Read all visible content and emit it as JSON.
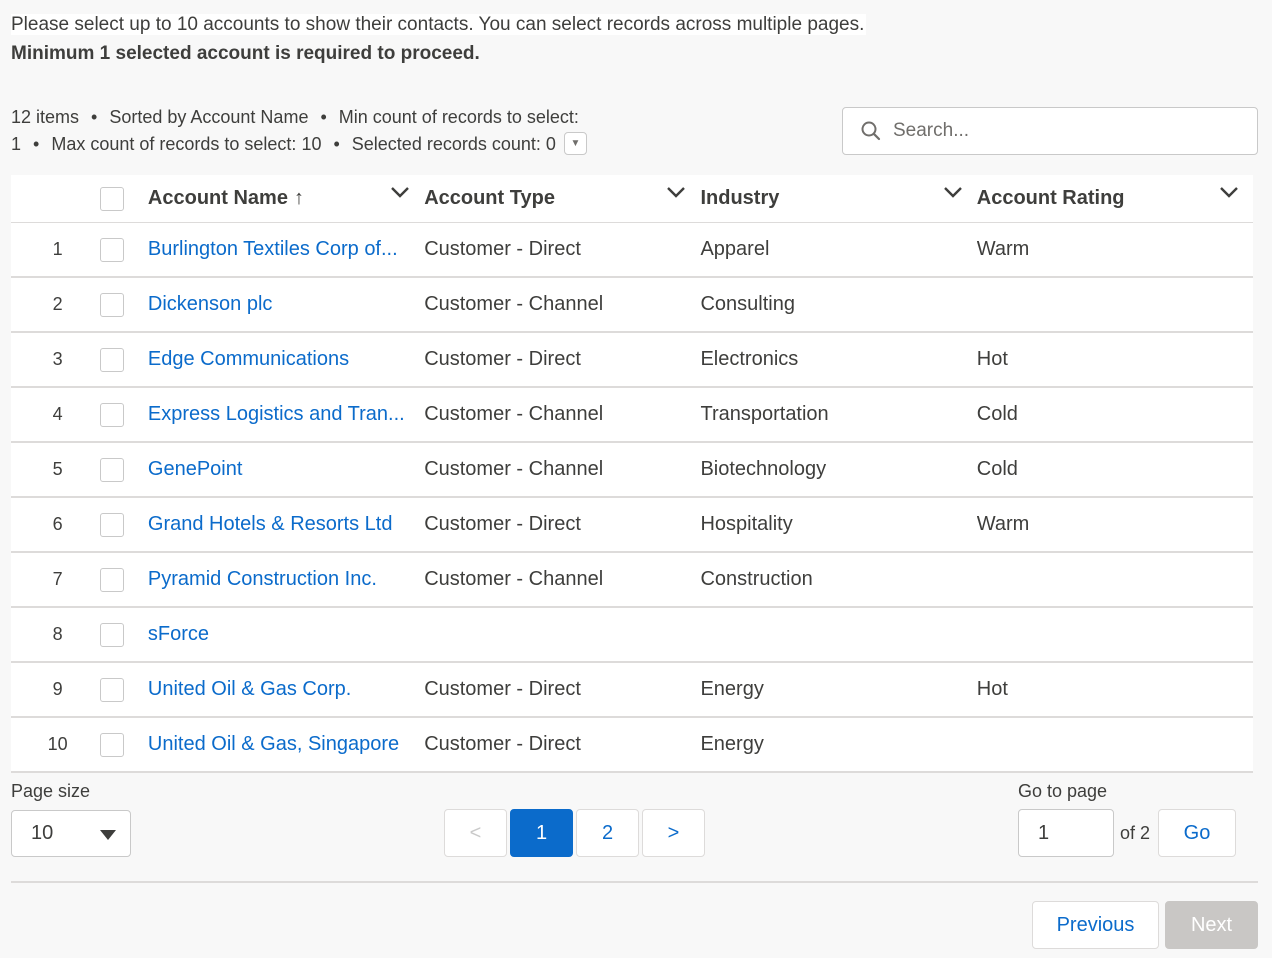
{
  "intro": {
    "line1": "Please select up to 10 accounts to show their contacts. You can select records across multiple pages.",
    "line2": "Minimum 1 selected account is required to proceed."
  },
  "meta": {
    "items": "12 items",
    "sorted": "Sorted by Account Name",
    "min_label": "Min count of records to select:",
    "min_value": "1",
    "max": "Max count of records to select: 10",
    "selected": "Selected records count: 0"
  },
  "search": {
    "placeholder": "Search..."
  },
  "table": {
    "columns": [
      "Account Name",
      "Account Type",
      "Industry",
      "Account Rating"
    ],
    "sort_arrow": "↑",
    "rows": [
      {
        "num": "1",
        "name": "Burlington Textiles Corp of...",
        "type": "Customer - Direct",
        "industry": "Apparel",
        "rating": "Warm"
      },
      {
        "num": "2",
        "name": "Dickenson plc",
        "type": "Customer - Channel",
        "industry": "Consulting",
        "rating": ""
      },
      {
        "num": "3",
        "name": "Edge Communications",
        "type": "Customer - Direct",
        "industry": "Electronics",
        "rating": "Hot"
      },
      {
        "num": "4",
        "name": "Express Logistics and Tran...",
        "type": "Customer - Channel",
        "industry": "Transportation",
        "rating": "Cold"
      },
      {
        "num": "5",
        "name": "GenePoint",
        "type": "Customer - Channel",
        "industry": "Biotechnology",
        "rating": "Cold"
      },
      {
        "num": "6",
        "name": "Grand Hotels & Resorts Ltd",
        "type": "Customer - Direct",
        "industry": "Hospitality",
        "rating": "Warm"
      },
      {
        "num": "7",
        "name": "Pyramid Construction Inc.",
        "type": "Customer - Channel",
        "industry": "Construction",
        "rating": ""
      },
      {
        "num": "8",
        "name": "sForce",
        "type": "",
        "industry": "",
        "rating": ""
      },
      {
        "num": "9",
        "name": "United Oil & Gas Corp.",
        "type": "Customer - Direct",
        "industry": "Energy",
        "rating": "Hot"
      },
      {
        "num": "10",
        "name": "United Oil & Gas, Singapore",
        "type": "Customer - Direct",
        "industry": "Energy",
        "rating": ""
      }
    ]
  },
  "pagination": {
    "page_size_label": "Page size",
    "page_size_value": "10",
    "prev_arrow": "<",
    "next_arrow": ">",
    "pages": [
      "1",
      "2"
    ],
    "current_page": "1",
    "goto_label": "Go to page",
    "goto_value": "1",
    "of_text": "of 2",
    "go_label": "Go"
  },
  "footer": {
    "previous_label": "Previous",
    "next_label": "Next"
  },
  "colors": {
    "brand": "#0b6bcb",
    "disabled": "#c9c7c5",
    "border": "#dddbda"
  }
}
